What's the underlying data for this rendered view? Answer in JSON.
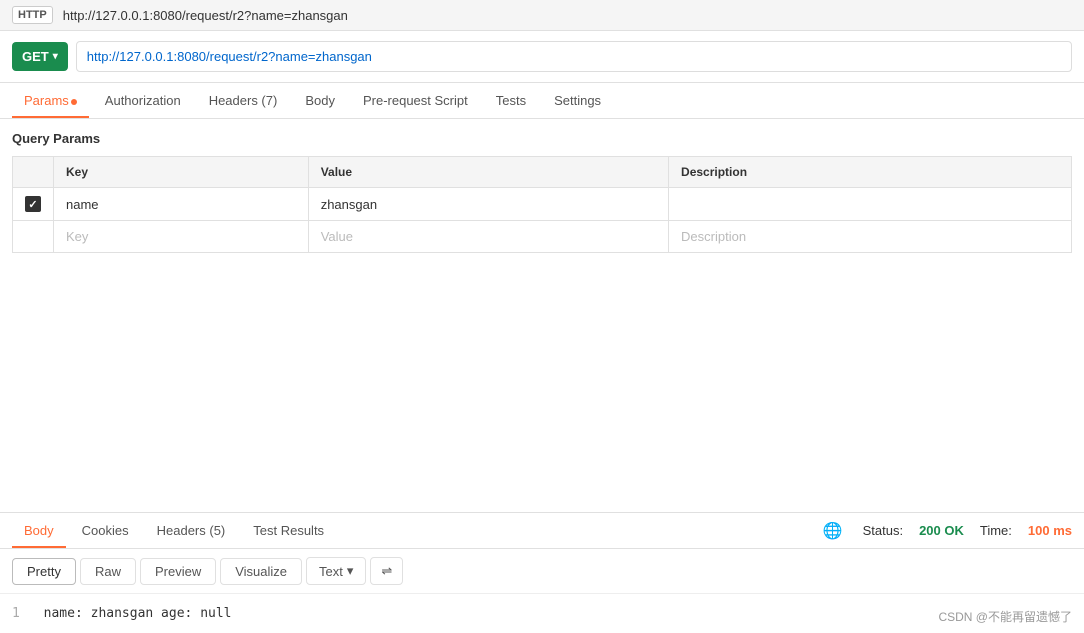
{
  "topbar": {
    "http_badge": "HTTP",
    "url": "http://127.0.0.1:8080/request/r2?name=zhansgan"
  },
  "request": {
    "method": "GET",
    "url": "http://127.0.0.1:8080/request/r2?name=zhansgan"
  },
  "request_tabs": [
    {
      "label": "Params",
      "active": true,
      "dot": true
    },
    {
      "label": "Authorization",
      "active": false,
      "dot": false
    },
    {
      "label": "Headers (7)",
      "active": false,
      "dot": false
    },
    {
      "label": "Body",
      "active": false,
      "dot": false
    },
    {
      "label": "Pre-request Script",
      "active": false,
      "dot": false
    },
    {
      "label": "Tests",
      "active": false,
      "dot": false
    },
    {
      "label": "Settings",
      "active": false,
      "dot": false
    }
  ],
  "query_params": {
    "section_title": "Query Params",
    "columns": [
      "Key",
      "Value",
      "Description"
    ],
    "rows": [
      {
        "checked": true,
        "key": "name",
        "value": "zhansgan",
        "description": ""
      },
      {
        "checked": false,
        "key": "",
        "value": "",
        "description": ""
      }
    ],
    "placeholder_key": "Key",
    "placeholder_value": "Value",
    "placeholder_description": "Description"
  },
  "response_tabs": [
    {
      "label": "Body",
      "active": true
    },
    {
      "label": "Cookies",
      "active": false
    },
    {
      "label": "Headers (5)",
      "active": false
    },
    {
      "label": "Test Results",
      "active": false
    }
  ],
  "response_status": {
    "status_label": "Status:",
    "status_value": "200 OK",
    "time_label": "Time:",
    "time_value": "100 ms"
  },
  "response_toolbar": {
    "pretty": "Pretty",
    "raw": "Raw",
    "preview": "Preview",
    "visualize": "Visualize",
    "text": "Text",
    "wrap_unicode": "⇌"
  },
  "response_body": {
    "line_number": "1",
    "content": "name: zhansgan age: null"
  },
  "watermark": "CSDN @不能再留遗憾了"
}
